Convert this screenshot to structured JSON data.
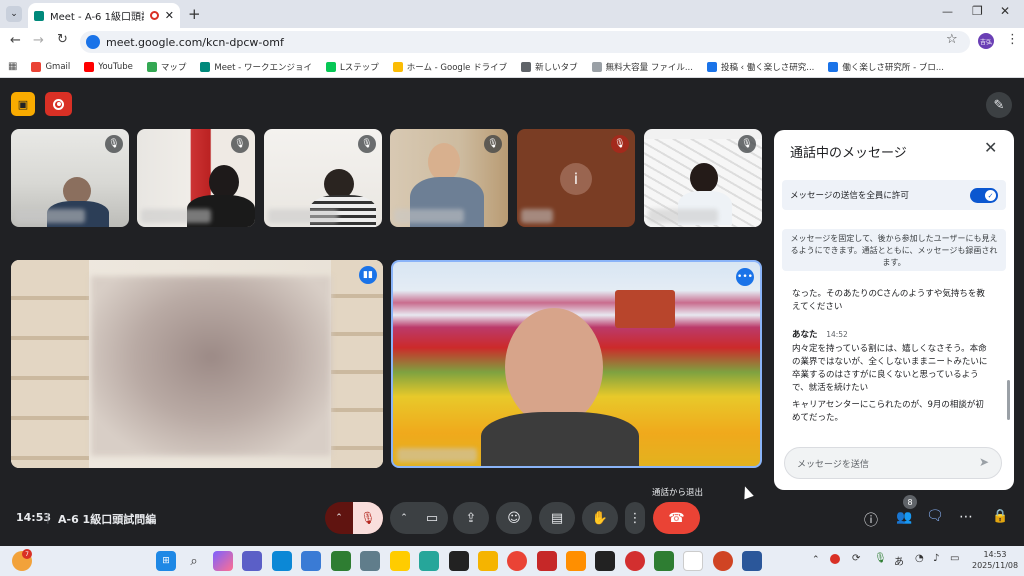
{
  "browser": {
    "tab_title": "Meet - A-6 1級口頭試問編",
    "new_tab": "+",
    "url": "meet.google.com/kcn-dpcw-omf",
    "profile": "吉弘",
    "bookmarks": [
      {
        "label": "Gmail",
        "color": "#ea4335"
      },
      {
        "label": "YouTube",
        "color": "#ff0000"
      },
      {
        "label": "マップ",
        "color": "#34a853"
      },
      {
        "label": "Meet - ワークエンジョイ",
        "color": "#00897b"
      },
      {
        "label": "Lステップ",
        "color": "#06c755"
      },
      {
        "label": "ホーム - Google ドライブ",
        "color": "#fbbc04"
      },
      {
        "label": "新しいタブ",
        "color": "#5f6368"
      },
      {
        "label": "無料大容量 ファイル...",
        "color": "#9aa0a6"
      },
      {
        "label": "投稿 ‹ 働く楽しさ研究...",
        "color": "#1a73e8"
      },
      {
        "label": "働く楽しさ研究所 - ブロ...",
        "color": "#1a73e8"
      }
    ]
  },
  "meeting": {
    "time": "14:53",
    "title": "A-6 1級口頭試問編",
    "participant_count": "8",
    "leave_tooltip": "通話から退出",
    "accent": "#0b57d0",
    "end_call_color": "#ea4335"
  },
  "participants": [
    {
      "initial": ""
    },
    {
      "initial": ""
    },
    {
      "initial": ""
    },
    {
      "initial": ""
    },
    {
      "initial": "i"
    },
    {
      "initial": ""
    }
  ],
  "chat": {
    "title": "通話中のメッセージ",
    "allow_label": "メッセージの送信を全員に許可",
    "pin_notice": "メッセージを固定して、後から参加したユーザーにも見えるようにできます。通話とともに、メッセージも録画されます。",
    "prev_message": "なった。そのあたりのCさんのようすや気持ちを教えてください",
    "sender": "あなた",
    "sent_time": "14:52",
    "message1": "内々定を持っている割には、嬉しくなさそう。本命の業界ではないが、全くしないままニートみたいに卒業するのはさすがに良くないと思っているようで、就活を続けたい",
    "message2": "キャリアセンターにこられたのが、9月の相談が初めてだった。",
    "input_placeholder": "メッセージを送信"
  },
  "taskbar": {
    "time": "14:53",
    "date": "2025/11/08",
    "notification_count": "7",
    "ime": "あ"
  }
}
